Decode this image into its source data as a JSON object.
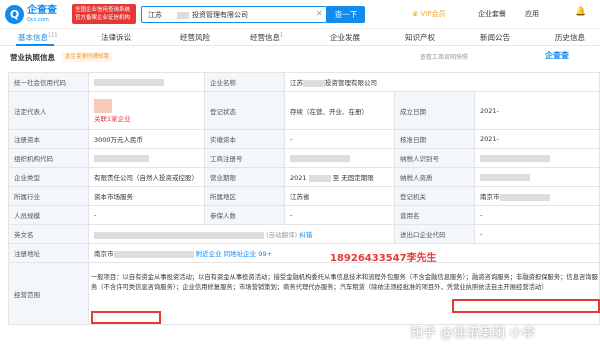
{
  "header": {
    "logo_text": "企查查",
    "logo_sub": "Qcc.com",
    "badge_line1": "全国企业信用查询系统",
    "badge_line2": "官方备案企业征信机构",
    "search_value": "江苏",
    "search_suffix": "投资管理有限公司",
    "search_button": "查一下",
    "vip": "VIP会员",
    "link1": "企业套餐",
    "link2": "应用"
  },
  "tabs": [
    {
      "label": "基本信息",
      "count": "111"
    },
    {
      "label": "法律诉讼"
    },
    {
      "label": "经营风险"
    },
    {
      "label": "经营信息",
      "count": "1"
    },
    {
      "label": "企业发展"
    },
    {
      "label": "知识产权"
    },
    {
      "label": "新闻公告"
    },
    {
      "label": "历史信息"
    }
  ],
  "section": {
    "title": "营业执照信息",
    "verified": "发生变更时通知我",
    "hint": "查看工商官网快照",
    "logo": "企查查"
  },
  "rows": {
    "credit_code": "统一社会信用代码",
    "name_label": "企业名称",
    "name_value": "江苏",
    "name_suffix": "投资管理有限公司",
    "legal_label": "法定代表人",
    "legal_assoc": "关联1家企业",
    "reg_status_label": "登记状态",
    "reg_status": "存续（在营、开业、在册）",
    "est_label": "成立日期",
    "est_value": "2021-",
    "capital_label": "注册资本",
    "capital_value": "3000万元人民币",
    "paid_label": "实缴资本",
    "paid_value": "-",
    "approve_label": "核准日期",
    "approve_value": "2021-",
    "org_label": "组织机构代码",
    "biz_reg_label": "工商注册号",
    "taxpayer_label": "纳税人识别号",
    "type_label": "企业类型",
    "type_value": "有限责任公司（自然人投资或控股）",
    "term_label": "营业期限",
    "term_value": "2021",
    "term_suffix": "至 无固定期限",
    "tax_q_label": "纳税人资质",
    "industry_label": "所属行业",
    "industry_value": "资本市场服务",
    "region_label": "所属地区",
    "region_value": "江苏省",
    "authority_label": "登记机关",
    "authority_value": "南京市",
    "staff_label": "人员规模",
    "staff_value": "-",
    "insured_label": "参保人数",
    "insured_value": "-",
    "former_label": "曾用名",
    "former_value": "-",
    "en_label": "英文名",
    "en_value": "(自动翻译)",
    "en_link": "纠错",
    "import_label": "进出口企业代码",
    "import_value": "-",
    "addr_label": "注册地址",
    "addr_value": "南京市",
    "addr_nearby": "附近企业",
    "addr_same": "同地址企业 99+",
    "phone": "18926433547李先生",
    "scope_label": "经营范围",
    "scope_text": "一般项目：以自有资金从事投资活动；以自有资金从事投资活动；接受金融机构委托从事信息技术和流程外包服务（不含金融信息服务）；融资咨询服务；非融资担保服务；信息咨询服务（不含许可类信息咨询服务）；企业信用修复服务；市场营销策划；商务代理代办服务；汽车租赁（除依法须经批准的项目外，凭营业执照依法自主开展经营活动）"
  },
  "watermark": "知乎 @佳诺集团 小李"
}
